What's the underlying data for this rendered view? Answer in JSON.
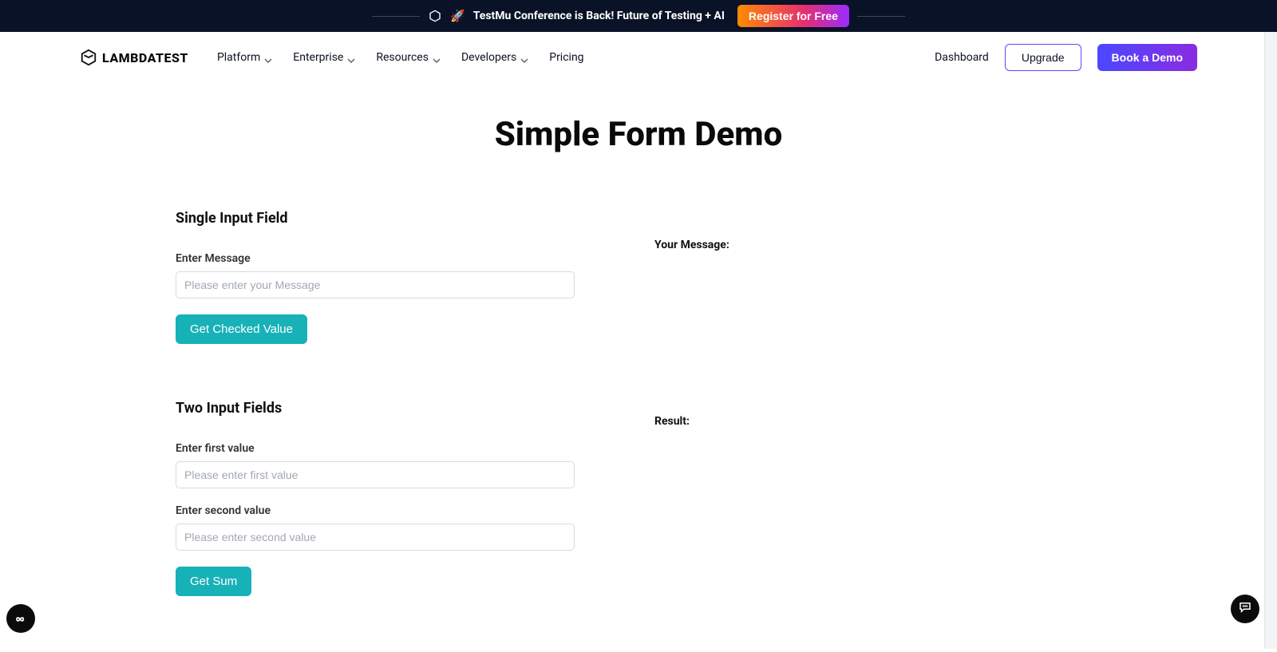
{
  "banner": {
    "text": "TestMu Conference is Back! Future of Testing + AI",
    "cta": "Register for Free"
  },
  "brand": {
    "name": "LAMBDATEST"
  },
  "nav": {
    "items": [
      {
        "label": "Platform",
        "chev": true
      },
      {
        "label": "Enterprise",
        "chev": true
      },
      {
        "label": "Resources",
        "chev": true
      },
      {
        "label": "Developers",
        "chev": true
      },
      {
        "label": "Pricing",
        "chev": false
      }
    ],
    "dashboard": "Dashboard",
    "upgrade": "Upgrade",
    "book_demo": "Book a Demo"
  },
  "hero": {
    "title": "Simple Form Demo"
  },
  "section1": {
    "title": "Single Input Field",
    "label": "Enter Message",
    "placeholder": "Please enter your Message",
    "value": "",
    "button": "Get Checked Value",
    "result_label": "Your Message:"
  },
  "section2": {
    "title": "Two Input Fields",
    "first_label": "Enter first value",
    "first_placeholder": "Please enter first value",
    "first_value": "",
    "second_label": "Enter second value",
    "second_placeholder": "Please enter second value",
    "second_value": "",
    "button": "Get Sum",
    "result_label": "Result:"
  }
}
